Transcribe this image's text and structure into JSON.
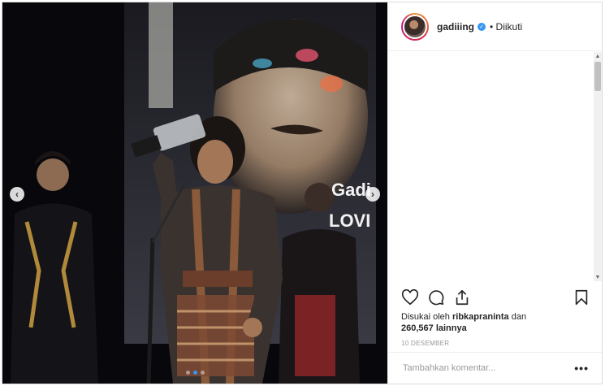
{
  "post": {
    "username": "gadiiing",
    "verified_icon": "verified-badge-icon",
    "follow_status": "• Diikuti",
    "likes_prefix": "Disukai oleh",
    "liked_by": "ribkapraninta",
    "likes_conj": "dan",
    "likes_count": "260,567 lainnya",
    "date": "10 DESEMBER",
    "comment_placeholder": "Tambahkan komentar...",
    "more_label": "•••"
  },
  "photo": {
    "screen_text_1": "Gadi",
    "screen_text_2": "LOVI",
    "carousel_total": 3,
    "carousel_active": 2
  },
  "colors": {
    "accent": "#3897f0",
    "border": "#dbdbdb"
  }
}
